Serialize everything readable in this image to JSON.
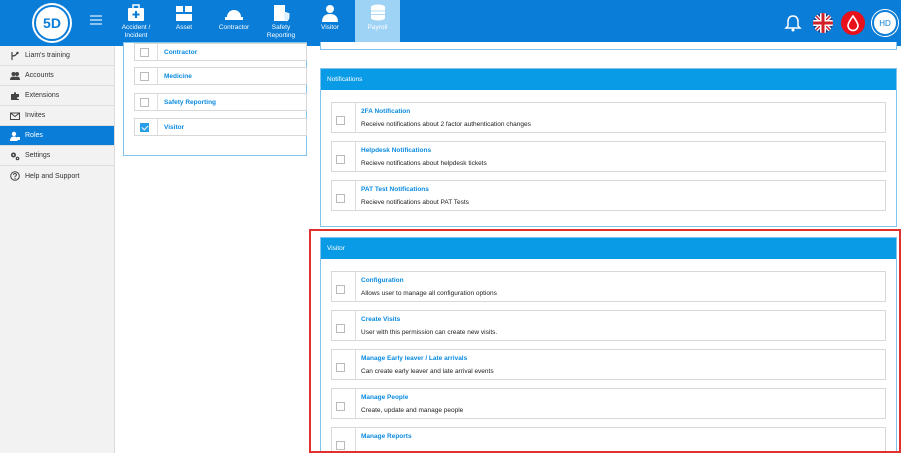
{
  "brand": {
    "logo_text": "5D"
  },
  "topnav": [
    {
      "name": "accident-incident",
      "label_line1": "Accident /",
      "label_line2": "Incident",
      "icon": "first-aid-kit-icon"
    },
    {
      "name": "asset",
      "label_line1": "Asset",
      "label_line2": "",
      "icon": "boxes-icon"
    },
    {
      "name": "contractor",
      "label_line1": "Contractor",
      "label_line2": "",
      "icon": "hard-hat-icon"
    },
    {
      "name": "safety-reporting",
      "label_line1": "Safety",
      "label_line2": "Reporting",
      "icon": "clipboard-shield-icon"
    },
    {
      "name": "visitor",
      "label_line1": "Visitor",
      "label_line2": "",
      "icon": "person-icon"
    },
    {
      "name": "payroll",
      "label_line1": "Payroll",
      "label_line2": "",
      "icon": "coins-icon"
    }
  ],
  "user": {
    "initials": "HD"
  },
  "colors": {
    "primary": "#0a7dd8",
    "header": "#0a9be6",
    "active_nav": "#9fd3f5",
    "highlight": "#e03030",
    "alert": "#e8101a"
  },
  "sidebar": {
    "items": [
      {
        "label": "Liam's training",
        "icon": "branch-icon"
      },
      {
        "label": "Accounts",
        "icon": "users-icon"
      },
      {
        "label": "Extensions",
        "icon": "puzzle-icon"
      },
      {
        "label": "Invites",
        "icon": "envelope-icon"
      },
      {
        "label": "Roles",
        "icon": "user-role-icon"
      },
      {
        "label": "Settings",
        "icon": "gears-icon"
      },
      {
        "label": "Help and Support",
        "icon": "help-icon"
      }
    ]
  },
  "modules_panel": {
    "items": [
      {
        "label": "Contractor",
        "checked": false
      },
      {
        "label": "Medicine",
        "checked": false
      },
      {
        "label": "Safety Reporting",
        "checked": false
      },
      {
        "label": "Visitor",
        "checked": true
      }
    ]
  },
  "notifications_panel": {
    "title": "Notifications",
    "items": [
      {
        "title": "2FA Notification",
        "desc": "Receive notifications about 2 factor authentication changes"
      },
      {
        "title": "Helpdesk Notifications",
        "desc": "Recieve notifications about helpdesk tickets"
      },
      {
        "title": "PAT Test Notifications",
        "desc": "Recieve notifications about PAT Tests"
      }
    ]
  },
  "visitor_panel": {
    "title": "Visitor",
    "items": [
      {
        "title": "Configuration",
        "desc": "Allows user to manage all configuration options"
      },
      {
        "title": "Create Visits",
        "desc": "User with this permission can create new visits."
      },
      {
        "title": "Manage Early leaver / Late arrivals",
        "desc": "Can create early leaver and late arrival events"
      },
      {
        "title": "Manage People",
        "desc": "Create, update and manage people"
      },
      {
        "title": "Manage Reports",
        "desc": ""
      }
    ]
  }
}
